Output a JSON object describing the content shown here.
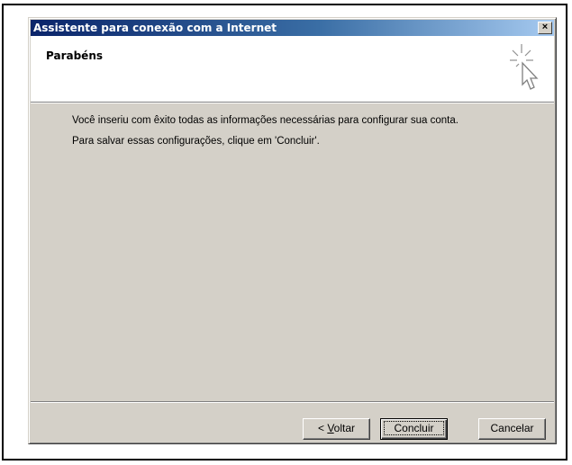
{
  "window": {
    "title": "Assistente para conexão com a Internet",
    "close_glyph": "×"
  },
  "header": {
    "title": "Parabéns",
    "icon": "wizard-cursor-sparkle-icon"
  },
  "content": {
    "line1": "Você inseriu com êxito todas as informações necessárias para configurar sua conta.",
    "line2": "Para salvar essas configurações, clique em 'Concluir'."
  },
  "buttons": {
    "back_prefix": "< ",
    "back_accel": "V",
    "back_rest": "oltar",
    "finish": "Concluir",
    "cancel": "Cancelar"
  },
  "colors": {
    "titlebar_start": "#0a246a",
    "titlebar_end": "#a6caf0",
    "dialog_face": "#d4d0c8"
  }
}
